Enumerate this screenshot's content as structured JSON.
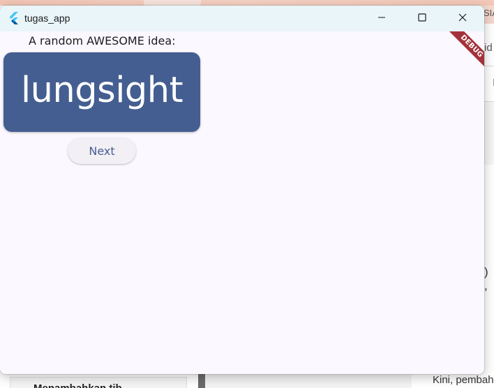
{
  "window": {
    "title": "tugas_app",
    "controls": [
      "minimize",
      "maximize",
      "close"
    ]
  },
  "content": {
    "prompt": "A random AWESOME idea:",
    "word": "lungsight",
    "next_label": "Next"
  },
  "debug_banner": "DEBUG",
  "background": {
    "right_header_text": "SIA",
    "right_field_text": "id",
    "right_field2_text": "I",
    "right_paren_text": ") ,",
    "bottom_card_text": "Menambahkan tib",
    "bottom_right_text": "Kini, pembah"
  },
  "colors": {
    "card": "#445e91",
    "surface": "#fcf8ff",
    "titlebar": "#e9f5f9",
    "button": "#f2eff5",
    "debug": "#a3323a"
  },
  "icons": {
    "app": "flutter-logo-icon",
    "minimize": "minimize-icon",
    "maximize": "maximize-icon",
    "close": "close-icon"
  }
}
